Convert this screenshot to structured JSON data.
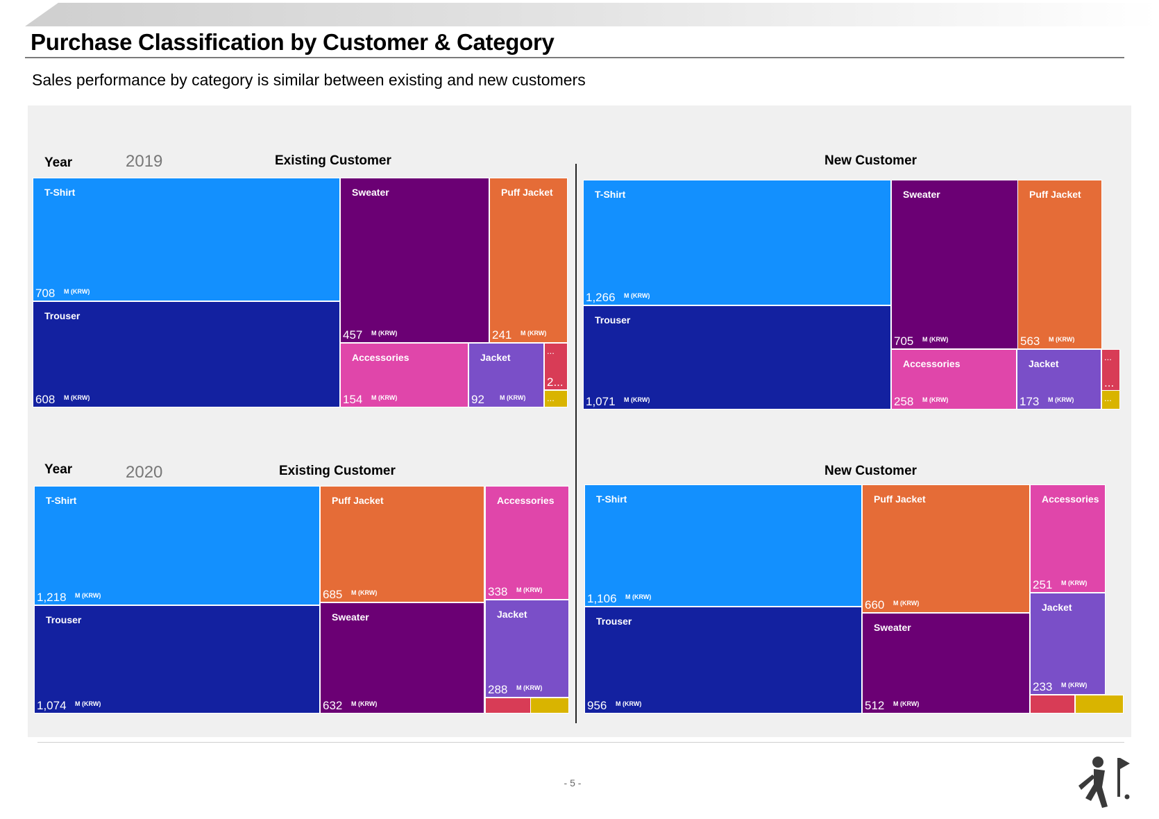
{
  "page": {
    "title": "Purchase Classification by Customer & Category",
    "subtitle": "Sales performance by category is similar between existing and new customers",
    "page_number": "- 5 -",
    "year_label": "Year",
    "logo_icon": "golfer-flag-logo-icon"
  },
  "colors": {
    "T-Shirt": "#1390fe",
    "Trouser": "#1321a0",
    "Sweater": "#6b0074",
    "Puff Jacket": "#e56c37",
    "Accessories": "#e046aa",
    "Jacket": "#7a4fc8",
    "Other Red": "#d83c56",
    "Other Yellow": "#d9b400"
  },
  "chart_data": [
    {
      "type": "treemap",
      "year": "2019",
      "segment": "Existing Customer",
      "unit": "M (KRW)",
      "items": [
        {
          "label": "T-Shirt",
          "value": 708,
          "display": "708"
        },
        {
          "label": "Trouser",
          "value": 608,
          "display": "608"
        },
        {
          "label": "Sweater",
          "value": 457,
          "display": "457"
        },
        {
          "label": "Puff Jacket",
          "value": 241,
          "display": "241"
        },
        {
          "label": "Accessories",
          "value": 154,
          "display": "154"
        },
        {
          "label": "Jacket",
          "value": 92,
          "display": "92"
        },
        {
          "label": "",
          "value": null,
          "display": "2...",
          "dots": "...",
          "color_key": "Other Red"
        },
        {
          "label": "",
          "value": null,
          "display": "",
          "dots": "...",
          "color_key": "Other Yellow"
        }
      ]
    },
    {
      "type": "treemap",
      "year": "2019",
      "segment": "New Customer",
      "unit": "M (KRW)",
      "items": [
        {
          "label": "T-Shirt",
          "value": 1266,
          "display": "1,266"
        },
        {
          "label": "Trouser",
          "value": 1071,
          "display": "1,071"
        },
        {
          "label": "Sweater",
          "value": 705,
          "display": "705"
        },
        {
          "label": "Puff Jacket",
          "value": 563,
          "display": "563"
        },
        {
          "label": "Accessories",
          "value": 258,
          "display": "258"
        },
        {
          "label": "Jacket",
          "value": 173,
          "display": "173"
        },
        {
          "label": "",
          "value": null,
          "display": "...",
          "dots": "...",
          "color_key": "Other Red"
        },
        {
          "label": "",
          "value": null,
          "display": "",
          "dots": "...",
          "color_key": "Other Yellow"
        }
      ]
    },
    {
      "type": "treemap",
      "year": "2020",
      "segment": "Existing Customer",
      "unit": "M (KRW)",
      "items": [
        {
          "label": "T-Shirt",
          "value": 1218,
          "display": "1,218"
        },
        {
          "label": "Trouser",
          "value": 1074,
          "display": "1,074"
        },
        {
          "label": "Puff Jacket",
          "value": 685,
          "display": "685"
        },
        {
          "label": "Sweater",
          "value": 632,
          "display": "632"
        },
        {
          "label": "Accessories",
          "value": 338,
          "display": "338"
        },
        {
          "label": "Jacket",
          "value": 288,
          "display": "288"
        },
        {
          "label": "",
          "value": null,
          "display": "",
          "color_key": "Other Red"
        },
        {
          "label": "",
          "value": null,
          "display": "",
          "color_key": "Other Yellow"
        }
      ]
    },
    {
      "type": "treemap",
      "year": "2020",
      "segment": "New Customer",
      "unit": "M (KRW)",
      "items": [
        {
          "label": "T-Shirt",
          "value": 1106,
          "display": "1,106"
        },
        {
          "label": "Trouser",
          "value": 956,
          "display": "956"
        },
        {
          "label": "Puff Jacket",
          "value": 660,
          "display": "660"
        },
        {
          "label": "Sweater",
          "value": 512,
          "display": "512"
        },
        {
          "label": "Accessories",
          "value": 251,
          "display": "251"
        },
        {
          "label": "Jacket",
          "value": 233,
          "display": "233"
        },
        {
          "label": "",
          "value": null,
          "display": "",
          "color_key": "Other Red"
        },
        {
          "label": "",
          "value": null,
          "display": "",
          "color_key": "Other Yellow"
        }
      ]
    }
  ]
}
